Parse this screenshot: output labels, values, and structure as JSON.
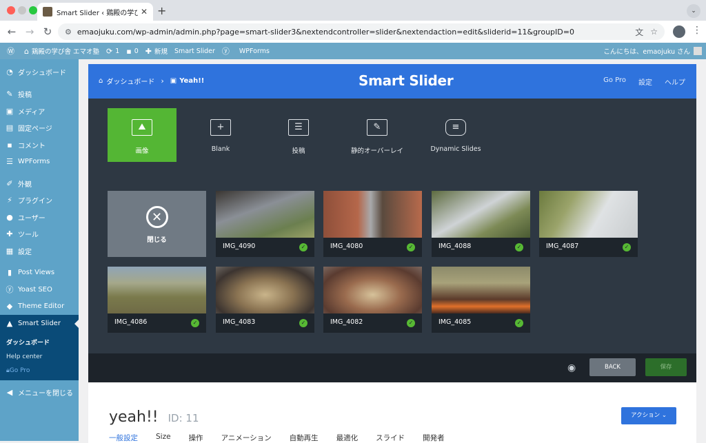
{
  "browser": {
    "tab_title": "Smart Slider ‹ 鶏殿の学び舎 エ…",
    "new_tab": "+",
    "url": "emaojuku.com/wp-admin/admin.php?page=smart-slider3&nextendcontroller=slider&nextendaction=edit&sliderid=11&groupID=0"
  },
  "adminbar": {
    "site": "鶏殿の学び舎 エマオ塾",
    "updates": "1",
    "comments": "0",
    "new": "新規",
    "smart_slider": "Smart Slider",
    "wpforms": "WPForms",
    "greeting": "こんにちは、emaojuku さん"
  },
  "sidebar": {
    "items": [
      {
        "label": "ダッシュボード",
        "icon": "dashboard-icon"
      },
      {
        "label": "投稿",
        "icon": "pin-icon"
      },
      {
        "label": "メディア",
        "icon": "media-icon"
      },
      {
        "label": "固定ページ",
        "icon": "page-icon"
      },
      {
        "label": "コメント",
        "icon": "comment-icon"
      },
      {
        "label": "WPForms",
        "icon": "forms-icon"
      },
      {
        "label": "外観",
        "icon": "brush-icon"
      },
      {
        "label": "プラグイン",
        "icon": "plugin-icon"
      },
      {
        "label": "ユーザー",
        "icon": "user-icon"
      },
      {
        "label": "ツール",
        "icon": "wrench-icon"
      },
      {
        "label": "設定",
        "icon": "settings-icon"
      },
      {
        "label": "Post Views",
        "icon": "chart-icon"
      },
      {
        "label": "Yoast SEO",
        "icon": "yoast-icon"
      },
      {
        "label": "Theme Editor",
        "icon": "diamond-icon"
      },
      {
        "label": "Smart Slider",
        "icon": "mortarboard-icon"
      }
    ],
    "sub": [
      "ダッシュボード",
      "Help center",
      "Go Pro"
    ],
    "collapse": "メニューを閉じる"
  },
  "ss": {
    "crumb_home": "ダッシュボード",
    "crumb_current": "Yeah!!",
    "logo": "Smart Slider",
    "menu": [
      "Go Pro",
      "設定",
      "ヘルプ"
    ],
    "types": [
      {
        "label": "画像",
        "icon": "image-icon"
      },
      {
        "label": "Blank",
        "icon": "plus-icon"
      },
      {
        "label": "投稿",
        "icon": "post-icon"
      },
      {
        "label": "静的オーバーレイ",
        "icon": "pin-icon"
      },
      {
        "label": "Dynamic Slides",
        "icon": "database-icon"
      }
    ],
    "close_label": "閉じる",
    "images": [
      "IMG_4090",
      "IMG_4080",
      "IMG_4088",
      "IMG_4087",
      "IMG_4086",
      "IMG_4083",
      "IMG_4082",
      "IMG_4085"
    ],
    "back": "BACK",
    "save": "保存",
    "slider_title": "yeah!!",
    "slider_id": "ID: 11",
    "action": "アクション",
    "tabs": [
      "一般設定",
      "Size",
      "操作",
      "アニメーション",
      "自動再生",
      "最適化",
      "スライド",
      "開発者"
    ]
  }
}
